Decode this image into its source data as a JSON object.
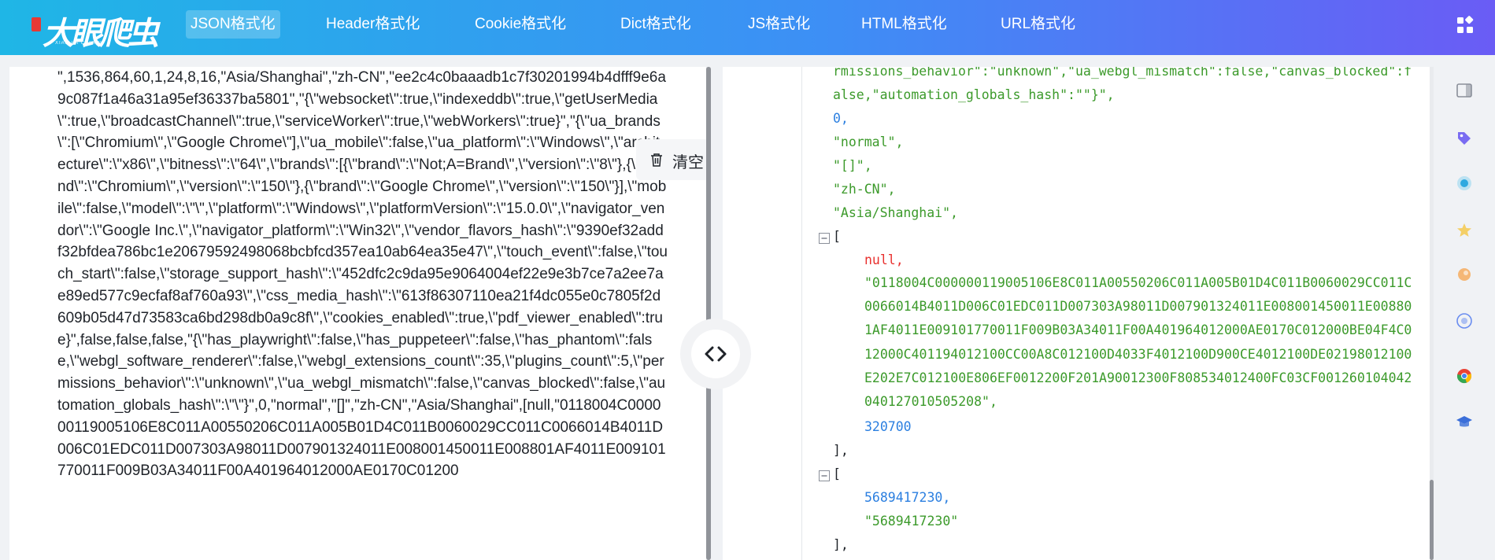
{
  "brand": {
    "logo_text": "大眼爬虫",
    "logo_subtext": "XIAN PA CHONG"
  },
  "nav": {
    "items": [
      {
        "label": "JSON格式化",
        "active": true
      },
      {
        "label": "Header格式化",
        "active": false
      },
      {
        "label": "Cookie格式化",
        "active": false
      },
      {
        "label": "Dict格式化",
        "active": false
      },
      {
        "label": "JS格式化",
        "active": false
      },
      {
        "label": "HTML格式化",
        "active": false
      },
      {
        "label": "URL格式化",
        "active": false
      }
    ]
  },
  "editor": {
    "clear_label": "清空",
    "text": "\",1536,864,60,1,24,8,16,\"Asia/Shanghai\",\"zh-CN\",\"ee2c4c0baaadb1c7f30201994b4dfff9e6a9c087f1a46a31a95ef36337ba5801\",\"{\\\"websocket\\\":true,\\\"indexeddb\\\":true,\\\"getUserMedia\\\":true,\\\"broadcastChannel\\\":true,\\\"serviceWorker\\\":true,\\\"webWorkers\\\":true}\",\"{\\\"ua_brands\\\":[\\\"Chromium\\\",\\\"Google Chrome\\\"],\\\"ua_mobile\\\":false,\\\"ua_platform\\\":\\\"Windows\\\",\\\"architecture\\\":\\\"x86\\\",\\\"bitness\\\":\\\"64\\\",\\\"brands\\\":[{\\\"brand\\\":\\\"Not;A=Brand\\\",\\\"version\\\":\\\"8\\\"},{\\\"brand\\\":\\\"Chromium\\\",\\\"version\\\":\\\"150\\\"},{\\\"brand\\\":\\\"Google Chrome\\\",\\\"version\\\":\\\"150\\\"}],\\\"mobile\\\":false,\\\"model\\\":\\\"\\\",\\\"platform\\\":\\\"Windows\\\",\\\"platformVersion\\\":\\\"15.0.0\\\",\\\"navigator_vendor\\\":\\\"Google Inc.\\\",\\\"navigator_platform\\\":\\\"Win32\\\",\\\"vendor_flavors_hash\\\":\\\"9390ef32addf32bfdea786bc1e20679592498068bcbfcd357ea10ab64ea35e47\\\",\\\"touch_event\\\":false,\\\"touch_start\\\":false,\\\"storage_support_hash\\\":\\\"452dfc2c9da95e9064004ef22e9e3b7ce7a2ee7ae89ed577c9ecfaf8af760a93\\\",\\\"css_media_hash\\\":\\\"613f86307110ea21f4dc055e0c7805f2d609b05d47d73583ca6bd298db0a9c8f\\\",\\\"cookies_enabled\\\":true,\\\"pdf_viewer_enabled\\\":true}\",false,false,false,\"{\\\"has_playwright\\\":false,\\\"has_puppeteer\\\":false,\\\"has_phantom\\\":false,\\\"webgl_software_renderer\\\":false,\\\"webgl_extensions_count\\\":35,\\\"plugins_count\\\":5,\\\"permissions_behavior\\\":\\\"unknown\\\",\\\"ua_webgl_mismatch\\\":false,\\\"canvas_blocked\\\":false,\\\"automation_globals_hash\\\":\\\"\\\"}\",0,\"normal\",\"[]\",\"zh-CN\",\"Asia/Shanghai\",[null,\"0118004C000000119005106E8C011A00550206C011A005B01D4C011B0060029CC011C0066014B4011D006C01EDC011D007303A98011D007901324011E008001450011E008801AF4011E009101770011F009B03A34011F00A401964012000AE0170C01200"
  },
  "viewer": {
    "line1": "rmissions_behavior\":\"unknown\",\"ua_webgl_mismatch\":false,\"canvas_blocked\":f",
    "line2": "alse,\"automation_globals_hash\":\"\"}\",",
    "line3": "0,",
    "line4": "\"normal\",",
    "line5": "\"[]\",",
    "line6": "\"zh-CN\",",
    "line7": "\"Asia/Shanghai\",",
    "bracket_open": "[",
    "null_value": "null,",
    "long_hex": "\"0118004C000000119005106E8C011A00550206C011A005B01D4C011B0060029CC011C0066014B4011D006C01EDC011D007303A98011D007901324011E008001450011E008801AF4011E009101770011F009B03A34011F00A401964012000AE0170C012000BE04F4C012000C401194012100CC00A8C012100D4033F4012100D900CE4012100DE02198012100E202E7C012100E806EF0012200F201A90012300F808534012400FC03CF001260104042040127010505208\",",
    "number_1": "320700",
    "bracket_close_1": "],",
    "bracket_open_2": "[",
    "number_2": "5689417230,",
    "string_2": "\"5689417230\"",
    "bracket_close_2": "],"
  },
  "colors": {
    "accent": "#3d8ff5",
    "string": "#3c9a2b",
    "number": "#2b7fe0",
    "null": "#e8302e"
  }
}
